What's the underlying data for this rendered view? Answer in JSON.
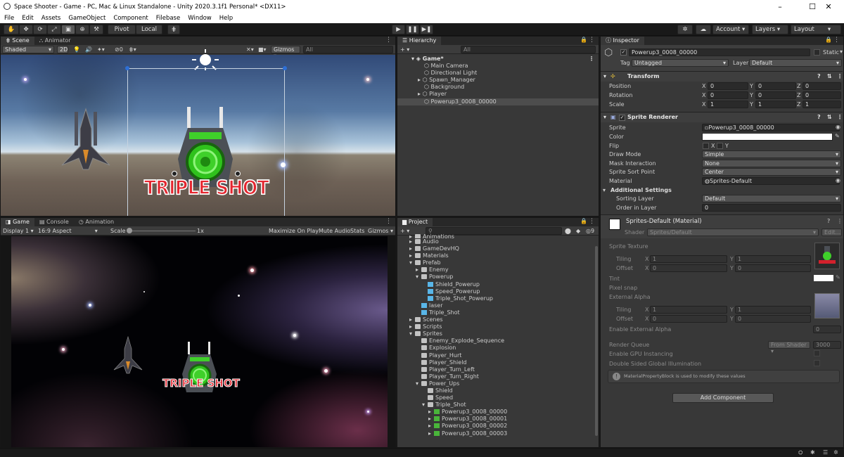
{
  "window": {
    "title": "Space Shooter - Game - PC, Mac & Linux Standalone - Unity 2020.3.1f1 Personal* <DX11>",
    "minimize": "–",
    "maximize": "☐",
    "close": "✕"
  },
  "menu": [
    "File",
    "Edit",
    "Assets",
    "GameObject",
    "Component",
    "Filebase",
    "Window",
    "Help"
  ],
  "toolbar": {
    "pivot": "Pivot",
    "local": "Local",
    "play": "▶",
    "pause": "❚❚",
    "step": "▶❚",
    "account": "Account",
    "layers": "Layers",
    "layout": "Layout"
  },
  "scene": {
    "tabs": [
      "Scene",
      "Animator"
    ],
    "shading": "Shaded",
    "mode2d": "2D",
    "gizmos": "Gizmos",
    "search": "All",
    "powerup_text": "TRIPLE SHOT"
  },
  "game": {
    "tabs": [
      "Game",
      "Console",
      "Animation"
    ],
    "display": "Display 1",
    "aspect": "16:9 Aspect",
    "scale_label": "Scale",
    "scale_value": "1x",
    "buttons": [
      "Maximize On Play",
      "Mute Audio",
      "Stats",
      "Gizmos"
    ],
    "powerup_text": "TRIPLE SHOT"
  },
  "hierarchy": {
    "tab": "Hierarchy",
    "search": "All",
    "root": "Game*",
    "items": [
      "Main Camera",
      "Directional Light",
      "Spawn_Manager",
      "Background",
      "Player",
      "Powerup3_0008_00000"
    ]
  },
  "project": {
    "tab": "Project",
    "items": [
      {
        "d": 1,
        "t": "Animations",
        "f": 1,
        "a": "▸"
      },
      {
        "d": 1,
        "t": "Audio",
        "f": 1,
        "a": "▸"
      },
      {
        "d": 1,
        "t": "GameDevHQ",
        "f": 1,
        "a": "▸"
      },
      {
        "d": 1,
        "t": "Materials",
        "f": 1,
        "a": "▸"
      },
      {
        "d": 1,
        "t": "Prefab",
        "f": 1,
        "a": "▾"
      },
      {
        "d": 2,
        "t": "Enemy",
        "f": 1,
        "a": "▸"
      },
      {
        "d": 2,
        "t": "Powerup",
        "f": 1,
        "a": "▾"
      },
      {
        "d": 3,
        "t": "Shield_Powerup",
        "f": 0,
        "a": ""
      },
      {
        "d": 3,
        "t": "Speed_Powerup",
        "f": 0,
        "a": ""
      },
      {
        "d": 3,
        "t": "Triple_Shot_Powerup",
        "f": 0,
        "a": ""
      },
      {
        "d": 2,
        "t": "laser",
        "f": 0,
        "a": ""
      },
      {
        "d": 2,
        "t": "Triple_Shot",
        "f": 0,
        "a": ""
      },
      {
        "d": 1,
        "t": "Scenes",
        "f": 1,
        "a": "▸"
      },
      {
        "d": 1,
        "t": "Scripts",
        "f": 1,
        "a": "▸"
      },
      {
        "d": 1,
        "t": "Sprites",
        "f": 1,
        "a": "▾"
      },
      {
        "d": 2,
        "t": "Enemy_Explode_Sequence",
        "f": 1,
        "a": ""
      },
      {
        "d": 2,
        "t": "Explosion",
        "f": 1,
        "a": ""
      },
      {
        "d": 2,
        "t": "Player_Hurt",
        "f": 1,
        "a": ""
      },
      {
        "d": 2,
        "t": "Player_Shield",
        "f": 1,
        "a": ""
      },
      {
        "d": 2,
        "t": "Player_Turn_Left",
        "f": 1,
        "a": ""
      },
      {
        "d": 2,
        "t": "Player_Turn_Right",
        "f": 1,
        "a": ""
      },
      {
        "d": 2,
        "t": "Power_Ups",
        "f": 1,
        "a": "▾"
      },
      {
        "d": 3,
        "t": "Shield",
        "f": 1,
        "a": ""
      },
      {
        "d": 3,
        "t": "Speed",
        "f": 1,
        "a": ""
      },
      {
        "d": 3,
        "t": "Triple_Shot",
        "f": 1,
        "a": "▾"
      },
      {
        "d": 4,
        "t": "Powerup3_0008_00000",
        "f": 2,
        "a": "▸"
      },
      {
        "d": 4,
        "t": "Powerup3_0008_00001",
        "f": 2,
        "a": "▸"
      },
      {
        "d": 4,
        "t": "Powerup3_0008_00002",
        "f": 2,
        "a": "▸"
      },
      {
        "d": 4,
        "t": "Powerup3_0008_00003",
        "f": 2,
        "a": "▸"
      }
    ],
    "zoom": "9"
  },
  "inspector": {
    "tab": "Inspector",
    "object_name": "Powerup3_0008_00000",
    "static": "Static",
    "tag_label": "Tag",
    "tag": "Untagged",
    "layer_label": "Layer",
    "layer": "Default",
    "transform": {
      "title": "Transform",
      "position": {
        "label": "Position",
        "x": "0",
        "y": "0",
        "z": "0"
      },
      "rotation": {
        "label": "Rotation",
        "x": "0",
        "y": "0",
        "z": "0"
      },
      "scale": {
        "label": "Scale",
        "x": "1",
        "y": "1",
        "z": "1"
      }
    },
    "sprite_renderer": {
      "title": "Sprite Renderer",
      "sprite_label": "Sprite",
      "sprite": "Powerup3_0008_00000",
      "color_label": "Color",
      "flip_label": "Flip",
      "flip_x": "X",
      "flip_y": "Y",
      "draw_mode_label": "Draw Mode",
      "draw_mode": "Simple",
      "mask_label": "Mask Interaction",
      "mask": "None",
      "sort_point_label": "Sprite Sort Point",
      "sort_point": "Center",
      "material_label": "Material",
      "material": "Sprites-Default",
      "additional": "Additional Settings",
      "sorting_layer_label": "Sorting Layer",
      "sorting_layer": "Default",
      "order_label": "Order in Layer",
      "order": "0"
    },
    "material": {
      "title": "Sprites-Default (Material)",
      "shader_label": "Shader",
      "shader": "Sprites/Default",
      "edit": "Edit...",
      "sprite_texture": "Sprite Texture",
      "tiling": "Tiling",
      "offset": "Offset",
      "tx": "1",
      "ty": "1",
      "ox": "0",
      "oy": "0",
      "tint": "Tint",
      "pixel_snap": "Pixel snap",
      "external_alpha": "External Alpha",
      "tiling2x": "1",
      "tiling2y": "1",
      "offset2x": "0",
      "offset2y": "0",
      "enable_ext_alpha": "Enable External Alpha",
      "enable_ext_alpha_val": "0",
      "render_queue": "Render Queue",
      "render_queue_mode": "From Shader",
      "render_queue_val": "3000",
      "gpu": "Enable GPU Instancing",
      "double_sided": "Double Sided Global Illumination",
      "info": "MaterialPropertyBlock is used to modify these values"
    },
    "add_component": "Add Component"
  },
  "colors": {
    "panel": "#383838",
    "accent": "#3a72b0",
    "green": "#41d12c",
    "red": "#d4202c"
  }
}
